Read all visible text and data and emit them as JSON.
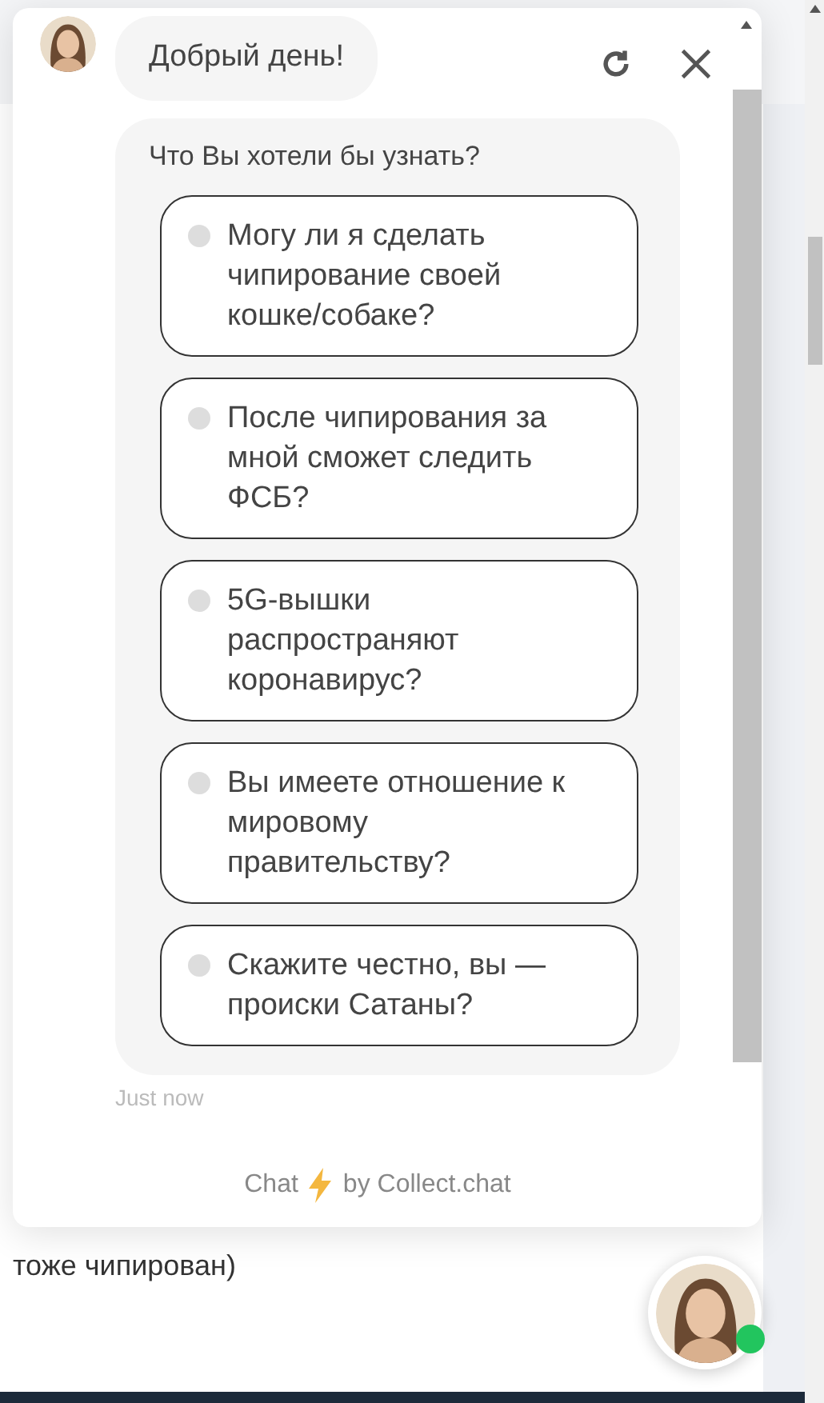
{
  "background_page": {
    "footer_line": "тоже чипирован)"
  },
  "chat": {
    "greeting": "Добрый день!",
    "question": "Что Вы хотели бы узнать?",
    "options": [
      {
        "label": "Могу ли я сделать чипирование своей кошке/собаке?"
      },
      {
        "label": "После чипирования за мной сможет следить ФСБ?"
      },
      {
        "label": "5G-вышки распространяют коронавирус?"
      },
      {
        "label": "Вы имеете отношение к мировому правительству?"
      },
      {
        "label": "Скажите честно, вы — происки Сатаны?"
      }
    ],
    "timestamp": "Just now",
    "footer": {
      "before": "Chat",
      "after": "by Collect.chat"
    }
  },
  "launcher": {
    "online": true
  }
}
